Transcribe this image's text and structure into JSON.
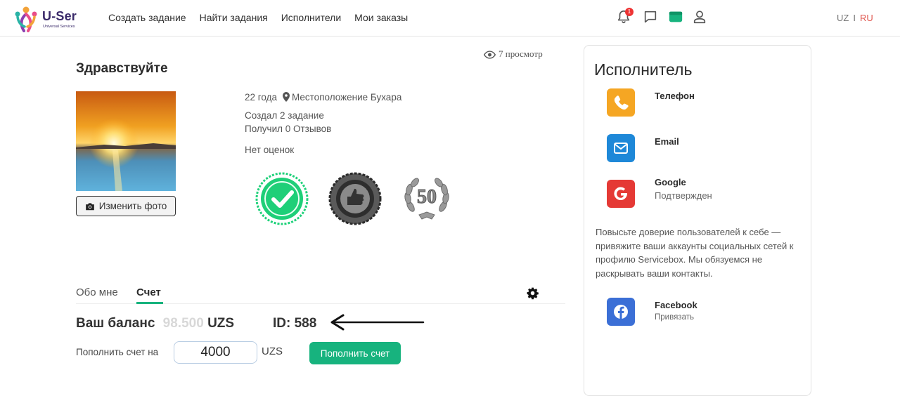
{
  "header": {
    "logo_name": "U-Ser",
    "logo_sub": "Universal Services",
    "nav": [
      "Создать задание",
      "Найти задания",
      "Исполнители",
      "Мои заказы"
    ],
    "notification_count": "1",
    "lang_uz": "UZ",
    "lang_sep": "I",
    "lang_ru": "RU",
    "accent_color": "#e0554d"
  },
  "profile": {
    "views": "7 просмотр",
    "greeting": "Здравствуйте",
    "change_photo": "Изменить фото",
    "age": "22 года",
    "location": "Местоположение Бухара",
    "created": "Создал 2 задание",
    "reviews": "Получил 0 Отзывов",
    "rating": "Нет оценок",
    "badge_50": "50"
  },
  "tabs": {
    "about": "Обо мне",
    "account": "Счет"
  },
  "account": {
    "balance_label": "Ваш баланс",
    "balance_amount": "98.500",
    "balance_currency": "UZS",
    "id_label": "ID: 588",
    "topup_label": "Пополнить счет на",
    "topup_value": "4000",
    "topup_currency": "UZS",
    "topup_button": "Пополнить счет",
    "button_color": "#17b37e"
  },
  "sidebar": {
    "title": "Исполнитель",
    "contacts": [
      {
        "name": "Телефон",
        "icon": "phone-icon",
        "color": "#f5a623"
      },
      {
        "name": "Email",
        "icon": "mail-icon",
        "color": "#1e88d8"
      },
      {
        "name": "Google",
        "sub": "Подтвержден",
        "icon": "google-icon",
        "color": "#e53935"
      },
      {
        "name": "Facebook",
        "sub": "Привязать",
        "icon": "facebook-icon",
        "color": "#3b6fd6"
      }
    ],
    "note": "Повысьте доверие пользователей к себе — привяжите ваши аккаунты социальных сетей к профилю Servicebox. Мы обязуемся не раскрывать ваши контакты."
  }
}
